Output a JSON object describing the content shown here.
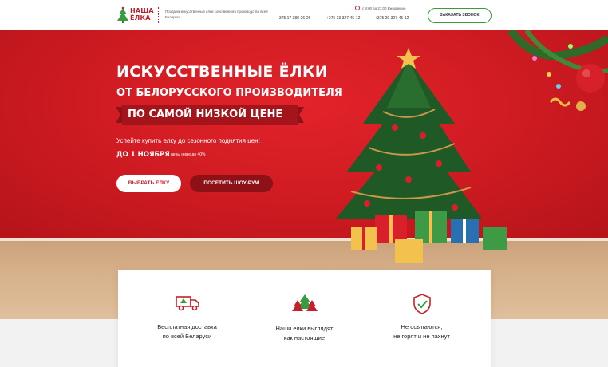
{
  "header": {
    "logo_text_line1": "НАША",
    "logo_text_line2": "ЁЛКА",
    "tagline": "Продаем искусственные елки собственного производства всей Беларуси",
    "hours": "с 9:00 до 21:00 Ежедневно",
    "phones": [
      "+375 17 388-26-26",
      "+375 33 327-45-12",
      "+375 29 327-45-12"
    ],
    "call_button": "ЗАКАЗАТЬ ЗВОНОК"
  },
  "hero": {
    "title_line1": "ИСКУССТВЕННЫЕ ЁЛКИ",
    "title_line2": "ОТ БЕЛОРУССКОГО ПРОИЗВОДИТЕЛЯ",
    "ribbon": "ПО САМОЙ НИЗКОЙ ЦЕНЕ",
    "offer": "Успейте купить елку до сезонного поднятия цен!",
    "deadline": "ДО 1 НОЯБРЯ",
    "discount": "цены ниже до 40%",
    "btn_choose": "ВЫБРАТЬ ЕЛКУ",
    "btn_showroom": "ПОСЕТИТЬ ШОУ-РУМ"
  },
  "features": [
    {
      "line1": "Бесплатная доставка",
      "line2": "по всей Беларуси",
      "icon": "delivery-truck-icon"
    },
    {
      "line1": "Наши елки выглядят",
      "line2": "как настоящие",
      "icon": "trees-icon"
    },
    {
      "line1": "Не осыпаются,",
      "line2": "не горят и не пахнут",
      "icon": "shield-check-icon"
    }
  ],
  "colors": {
    "brand_red": "#c61f2b",
    "accent_green": "#3a9a3f",
    "hero_bg": "#d31d25",
    "dark_red_button": "#8e1117"
  }
}
